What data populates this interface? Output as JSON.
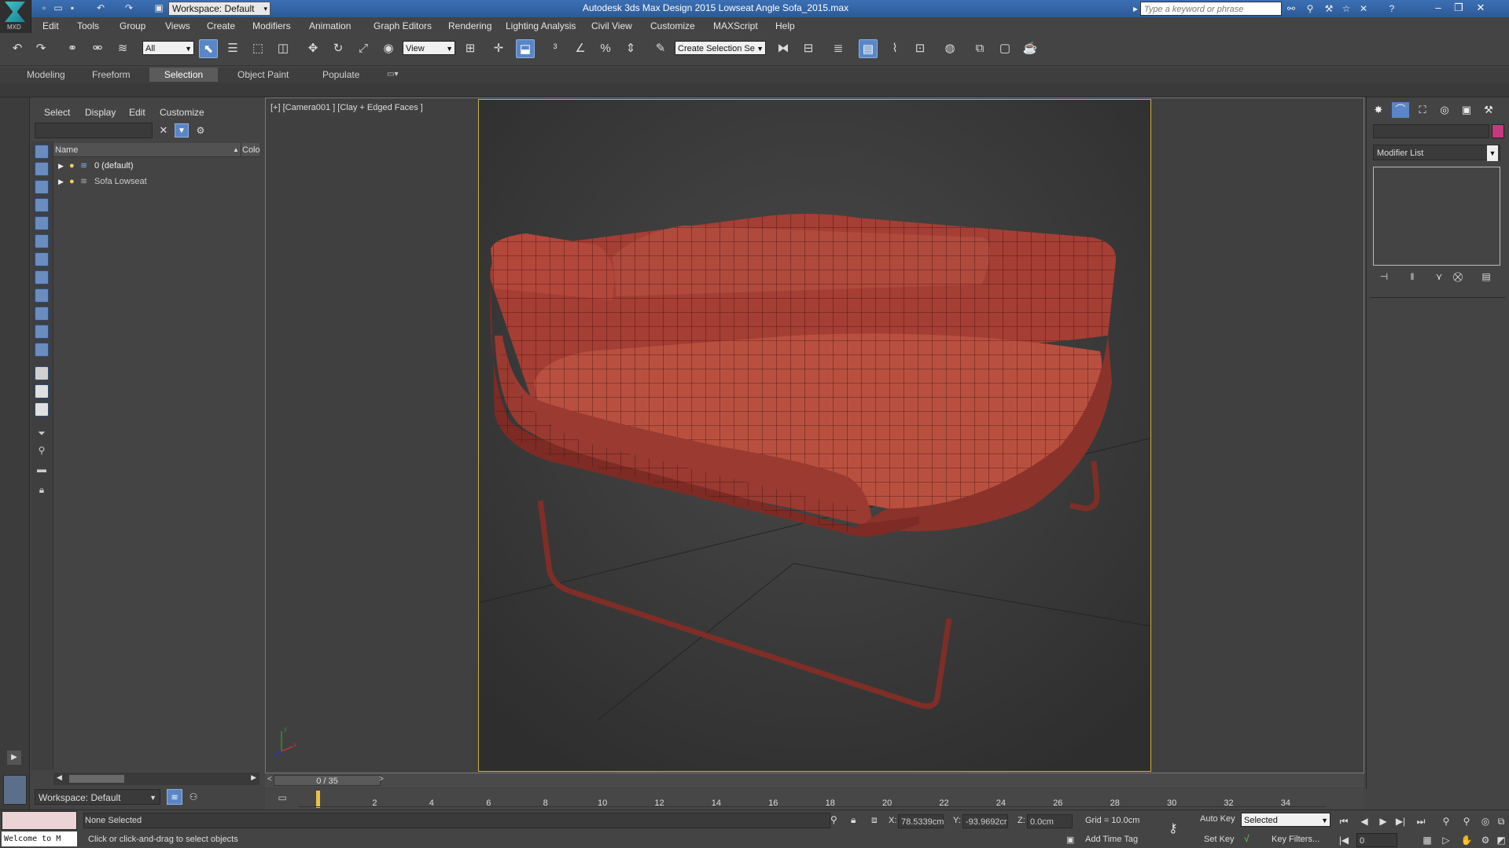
{
  "app": {
    "logo_label": "MXD",
    "workspace": "Workspace: Default",
    "window_title": "Autodesk 3ds Max Design 2015     Lowseat Angle Sofa_2015.max",
    "search_placeholder": "Type a keyword or phrase"
  },
  "menu": [
    "Edit",
    "Tools",
    "Group",
    "Views",
    "Create",
    "Modifiers",
    "Animation",
    "Graph Editors",
    "Rendering",
    "Lighting Analysis",
    "Civil View",
    "Customize",
    "MAXScript",
    "Help"
  ],
  "toolbar": {
    "filter": "All",
    "ref_coord": "View",
    "selection_set": "Create Selection Se"
  },
  "ribbon_tabs": [
    "Modeling",
    "Freeform",
    "Selection",
    "Object Paint",
    "Populate"
  ],
  "ribbon_active": "Selection",
  "explorer": {
    "menu": [
      "Select",
      "Display",
      "Edit",
      "Customize"
    ],
    "col_name": "Name",
    "col_color": "Colo",
    "rows": [
      {
        "label": "0 (default)"
      },
      {
        "label": "Sofa Lowseat"
      }
    ],
    "workspace": "Workspace: Default"
  },
  "viewport": {
    "label": "[+] [Camera001 ] [Clay + Edged Faces ]",
    "sofa_color": "#b1473c",
    "axis": {
      "y": "y",
      "x": "x",
      "z": "z"
    }
  },
  "command_panel": {
    "modifier_list": "Modifier List",
    "object_color": "#c53a7e"
  },
  "timeline": {
    "slider": "0 / 35",
    "ticks": [
      "2",
      "4",
      "6",
      "8",
      "10",
      "12",
      "14",
      "16",
      "18",
      "20",
      "22",
      "24",
      "26",
      "28",
      "30",
      "32",
      "34"
    ],
    "prev": "<",
    "next": ">"
  },
  "status": {
    "welcome": "Welcome to M",
    "selection": "None Selected",
    "prompt": "Click or click-and-drag to select objects",
    "x_label": "X:",
    "x": "78.5339cm",
    "y_label": "Y:",
    "y": "-93.9692cr",
    "z_label": "Z:",
    "z": "0.0cm",
    "grid": "Grid = 10.0cm",
    "add_time_tag": "Add Time Tag",
    "auto_key": "Auto Key",
    "set_key": "Set Key",
    "key_mode": "Selected",
    "key_filters": "Key Filters...",
    "frame": "0"
  }
}
